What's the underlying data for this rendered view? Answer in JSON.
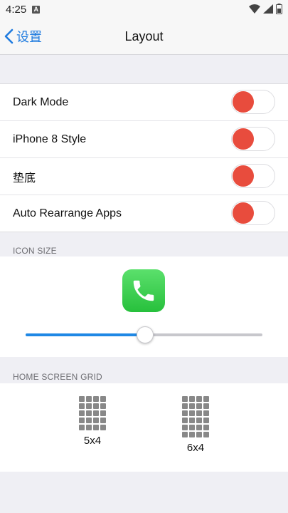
{
  "status_bar": {
    "time": "4:25",
    "notification_letter": "A"
  },
  "nav": {
    "back_label": "设置",
    "title": "Layout"
  },
  "toggles": [
    {
      "label": "Dark Mode",
      "state": "on"
    },
    {
      "label": "iPhone 8 Style",
      "state": "on"
    },
    {
      "label": "垫底",
      "state": "on"
    },
    {
      "label": "Auto Rearrange Apps",
      "state": "on"
    }
  ],
  "icon_size": {
    "header": "ICON SIZE",
    "icon": "phone-icon",
    "slider_value": 0.5
  },
  "home_grid": {
    "header": "HOME SCREEN GRID",
    "options": [
      {
        "label": "5x4",
        "rows": 5,
        "cols": 4
      },
      {
        "label": "6x4",
        "rows": 6,
        "cols": 4
      }
    ]
  },
  "colors": {
    "accent": "#1f7bdf",
    "toggle_knob": "#e84c3d",
    "app_green": "#34c84a",
    "slider_fill": "#1f88e5"
  }
}
